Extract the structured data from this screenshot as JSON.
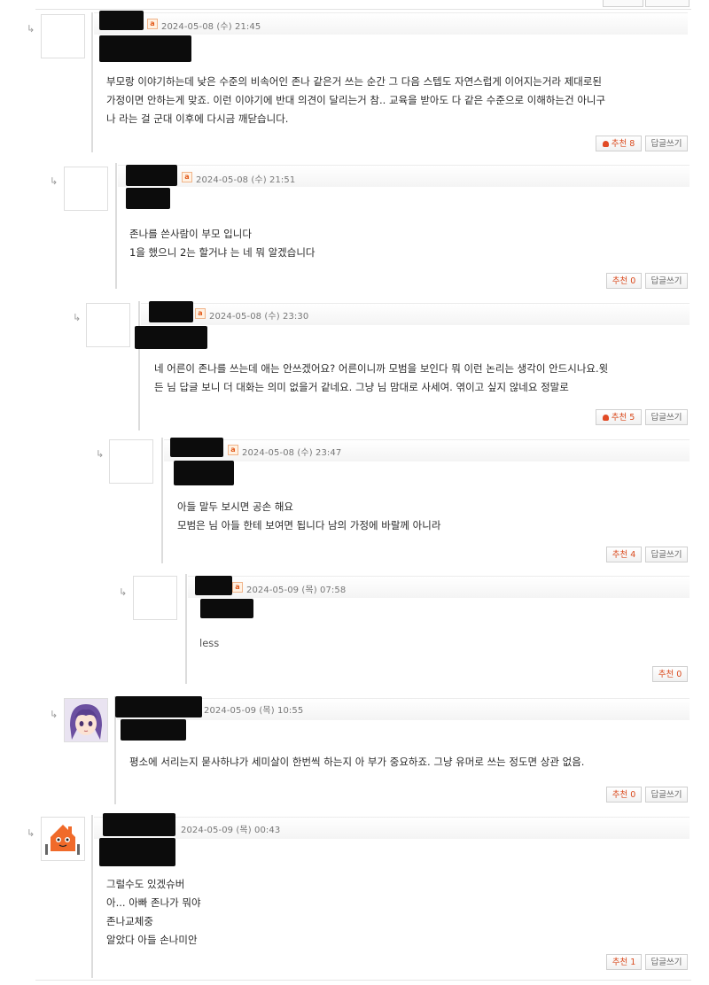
{
  "reply_marker": "↳",
  "level_badge": "a",
  "recommend_label": "추천",
  "reply_label": "답글쓰기",
  "colors": {
    "accent": "#d9491c",
    "border": "#dcdcdc",
    "meta": "#777777"
  },
  "comments": [
    {
      "timestamp": "2024-05-08 (수) 21:45",
      "lines": [
        "부모랑 이야기하는데 낮은 수준의 비속어인 존나 같은거 쓰는 순간 그 다음 스텝도 자연스럽게 이어지는거라 제대로된",
        "가정이면 안하는게 맞죠. 이런 이야기에 반대 의견이 달리는거 참.. 교육을 받아도 다 같은 수준으로 이해하는건 아니구",
        "나 라는 걸 군대 이후에 다시금 깨닫습니다."
      ],
      "recommend_count": "8"
    },
    {
      "timestamp": "2024-05-08 (수) 21:51",
      "lines": [
        "존나를 쓴사람이 부모 입니다",
        "1을 했으니 2는 할거냐 는 네 뭐 알겠습니다"
      ],
      "recommend_count": "0"
    },
    {
      "timestamp": "2024-05-08 (수) 23:30",
      "lines": [
        "네 어른이 존나를 쓰는데 애는 안쓰겠어요? 어른이니까 모범을 보인다 뭐 이런 논리는 생각이 안드시나요.윗",
        "든 님 답글 보니 더 대화는 의미 없을거 같네요. 그냥 님 맘대로 사세여. 엮이고 싶지 않네요 정말로"
      ],
      "recommend_count": "5"
    },
    {
      "timestamp": "2024-05-08 (수) 23:47",
      "lines": [
        "아들 말두 보시면 공손 해요",
        "모범은 님 아들 한테 보여면 됩니다 남의 가정에 바랄께 아니라"
      ],
      "recommend_count": "4"
    },
    {
      "timestamp": "2024-05-09 (목) 07:58",
      "lines": [
        "less"
      ],
      "recommend_count": "0"
    },
    {
      "timestamp": "2024-05-09 (목) 10:55",
      "lines": [
        "평소에 서리는지 묻사하냐가 세미살이 한번씩 하는지 아 부가 중요하죠. 그냥 유머로 쓰는 정도면 상관 없음."
      ],
      "recommend_count": "0"
    },
    {
      "timestamp": "2024-05-09 (목) 00:43",
      "lines": [
        "그럴수도 있겠슈버",
        "아... 아빠 존나가 뭐야",
        "존나교체중",
        "알았다 아들 손나미안"
      ],
      "recommend_count": "1"
    }
  ]
}
